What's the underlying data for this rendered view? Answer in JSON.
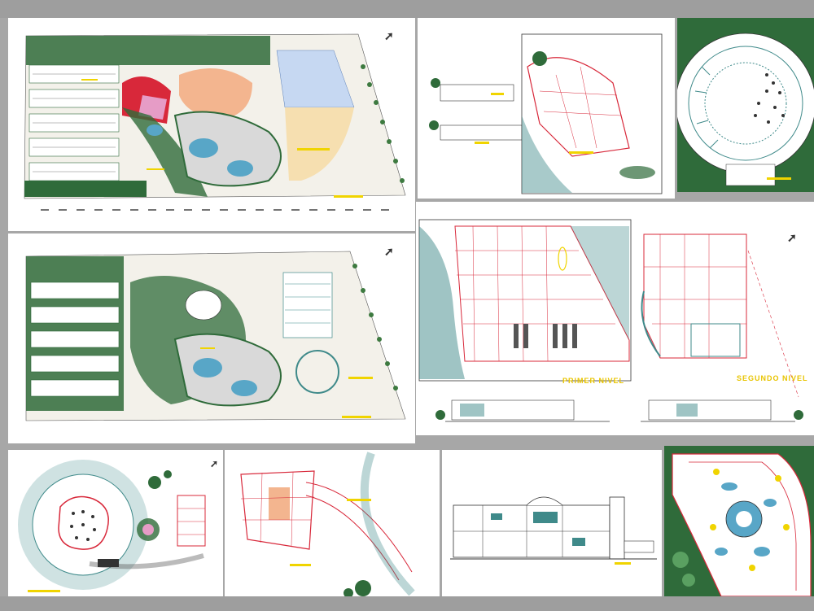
{
  "window": {
    "topbar_color": "#9e9e9e",
    "bottombar_color": "#9e9e9e"
  },
  "colors": {
    "vegetation": "#2f6b3a",
    "accent_red": "#d8283a",
    "accent_yellow": "#f0d400",
    "water": "#58a6c7",
    "paving": "#d9d9d9",
    "hatch_teal": "#3f8a8a",
    "pink": "#e69cc6",
    "salmon": "#f3b58f"
  },
  "icons": {
    "north_arrow": "north-arrow-icon",
    "tree": "tree-icon"
  },
  "labels": {
    "first_level": "PRIMER NIVEL",
    "second_level": "SEGUNDO NIVEL"
  }
}
